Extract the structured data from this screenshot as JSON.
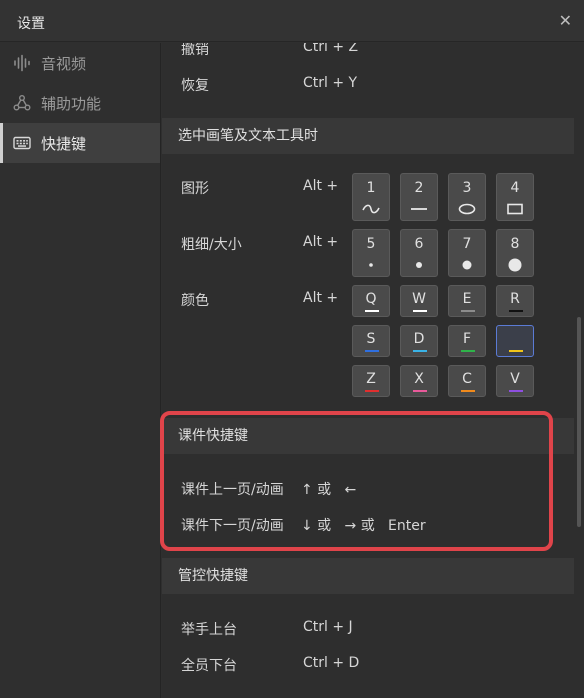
{
  "window": {
    "title": "设置",
    "close_glyph": "✕"
  },
  "sidebar": {
    "items": [
      {
        "label": "音视频",
        "icon": "audio-wave-icon"
      },
      {
        "label": "辅助功能",
        "icon": "accessibility-icon"
      },
      {
        "label": "快捷键",
        "icon": "keyboard-icon",
        "active": true
      }
    ]
  },
  "shortcuts_top": [
    {
      "label": "撤销",
      "keys": "Ctrl + Z"
    },
    {
      "label": "恢复",
      "keys": "Ctrl + Y"
    }
  ],
  "pen_section": {
    "title": "选中画笔及文本工具时",
    "shape": {
      "label": "图形",
      "modifier": "Alt +",
      "keys": [
        "1",
        "2",
        "3",
        "4"
      ]
    },
    "thickness": {
      "label": "粗细/大小",
      "modifier": "Alt +",
      "keys": [
        "5",
        "6",
        "7",
        "8"
      ]
    },
    "color": {
      "label": "颜色",
      "modifier": "Alt +",
      "keys": [
        {
          "letter": "Q",
          "color": "#ffffff"
        },
        {
          "letter": "W",
          "color": "#ffffff"
        },
        {
          "letter": "E",
          "color": "#8c8c8c"
        },
        {
          "letter": "R",
          "color": "#111111"
        },
        {
          "letter": "S",
          "color": "#2f6fe0"
        },
        {
          "letter": "D",
          "color": "#3ab3e6"
        },
        {
          "letter": "F",
          "color": "#2fb34a"
        },
        {
          "letter": "_",
          "color": "#f0c419",
          "selected": true
        },
        {
          "letter": "Z",
          "color": "#e02f2f"
        },
        {
          "letter": "X",
          "color": "#e85a9a"
        },
        {
          "letter": "C",
          "color": "#f08a1c"
        },
        {
          "letter": "V",
          "color": "#8e4fe0"
        }
      ]
    }
  },
  "courseware_section": {
    "title": "课件快捷键",
    "rows": [
      {
        "label": "课件上一页/动画",
        "keys": "↑ 或   ←"
      },
      {
        "label": "课件下一页/动画",
        "keys": "↓ 或   → 或   Enter"
      }
    ]
  },
  "control_section": {
    "title": "管控快捷键",
    "rows": [
      {
        "label": "举手上台",
        "keys": "Ctrl + J"
      },
      {
        "label": "全员下台",
        "keys": "Ctrl + D"
      }
    ]
  }
}
